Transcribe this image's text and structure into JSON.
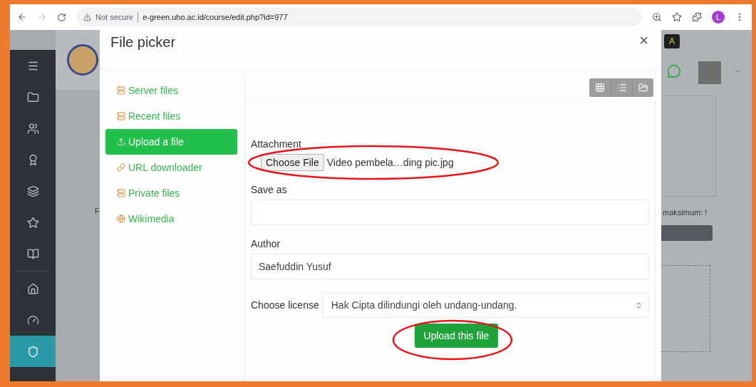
{
  "browser": {
    "security": "Not secure",
    "url": "e-green.uho.ac.id/course/edit.php?id=977",
    "profile_initial": "L"
  },
  "sidebar": {
    "items": [
      {
        "kind": "menu",
        "selected": false
      },
      {
        "kind": "folder",
        "selected": false
      },
      {
        "kind": "users",
        "selected": false
      },
      {
        "kind": "award",
        "selected": false
      },
      {
        "kind": "layers",
        "selected": false
      },
      {
        "kind": "star",
        "selected": false
      },
      {
        "kind": "book",
        "selected": false
      },
      {
        "kind": "home",
        "selected": false
      },
      {
        "kind": "gauge",
        "selected": false
      },
      {
        "kind": "shield",
        "selected": true
      }
    ]
  },
  "page": {
    "badge": "A",
    "left_fragment": "F",
    "right_fragment": "maksimum: !"
  },
  "dialog": {
    "title": "File picker",
    "close": "×",
    "repositories": [
      {
        "label": "Server files",
        "kind": "server",
        "selected": false
      },
      {
        "label": "Recent files",
        "kind": "server",
        "selected": false
      },
      {
        "label": "Upload a file",
        "kind": "upload",
        "selected": true
      },
      {
        "label": "URL downloader",
        "kind": "url",
        "selected": false
      },
      {
        "label": "Private files",
        "kind": "server",
        "selected": false
      },
      {
        "label": "Wikimedia",
        "kind": "globe",
        "selected": false
      }
    ],
    "view_buttons": [
      {
        "kind": "icons"
      },
      {
        "kind": "list"
      },
      {
        "kind": "tree"
      }
    ],
    "form": {
      "attachment_label": "Attachment",
      "choose_button": "Choose File",
      "file_name": "Video pembela…ding pic.jpg",
      "save_as_label": "Save as",
      "author_label": "Author",
      "author_value": "Saefuddin Yusuf",
      "license_label": "Choose license",
      "license_value": "Hak Cipta dilindungi oleh undang-undang.",
      "upload_button": "Upload this file"
    }
  }
}
